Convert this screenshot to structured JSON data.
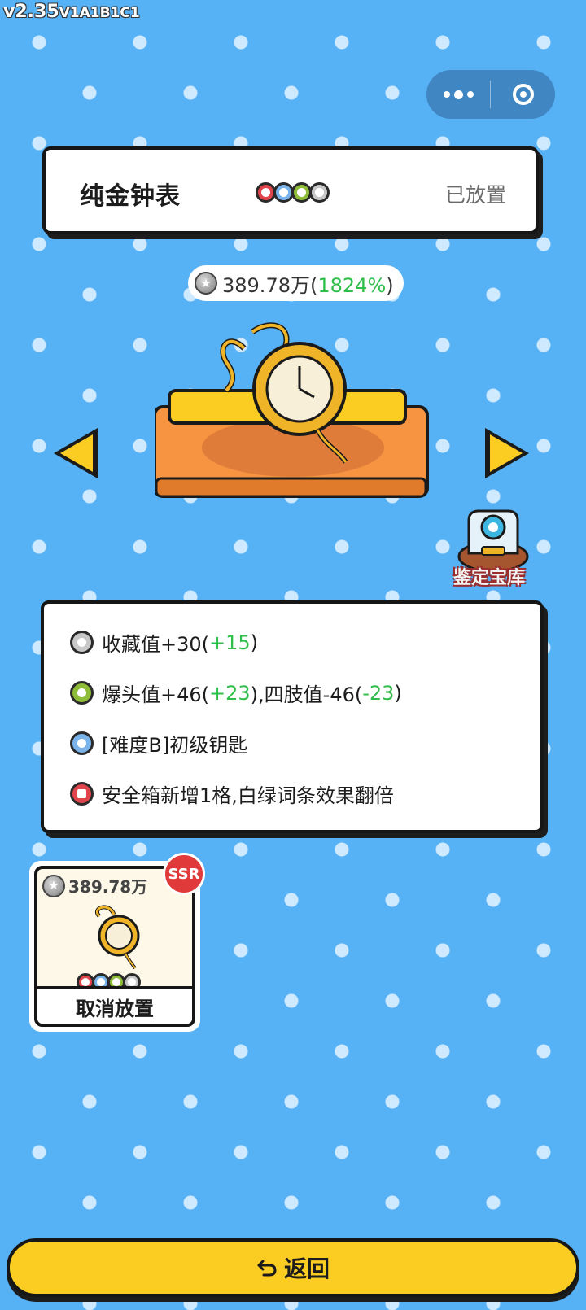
{
  "version": {
    "main": "v2.35",
    "build": "V1A1B1C1"
  },
  "capsule": {
    "more_icon": "more-dots-icon",
    "close_icon": "target-circle-icon"
  },
  "item": {
    "name": "纯金钟表",
    "status": "已放置",
    "gems": [
      "red",
      "blue",
      "green",
      "grey"
    ],
    "price": "389.78万",
    "price_pct_open": "(",
    "price_pct": "1824%",
    "price_pct_close": ")"
  },
  "vault": {
    "label": "鉴定宝库"
  },
  "stats": [
    {
      "color": "grey",
      "text": "收藏值+30(",
      "bonus": "+15",
      "tail": ")"
    },
    {
      "color": "green",
      "text": "爆头值+46(",
      "bonus": "+23",
      "tail": "),四肢值-46(",
      "bonus2": "-23",
      "tail2": ")"
    },
    {
      "color": "blue",
      "text": "[难度B]初级钥匙"
    },
    {
      "color": "red",
      "text": "安全箱新增1格,白绿词条效果翻倍"
    }
  ],
  "item_card": {
    "price": "389.78万",
    "rarity": "SSR",
    "cancel_label": "取消放置"
  },
  "back_button": {
    "label": "返回",
    "icon": "return-arrow-icon"
  },
  "colors": {
    "background": "#57b2f5",
    "accent_yellow": "#fbcd23",
    "bonus_green": "#2fbe4a",
    "ssr_red": "#e13a3a"
  }
}
